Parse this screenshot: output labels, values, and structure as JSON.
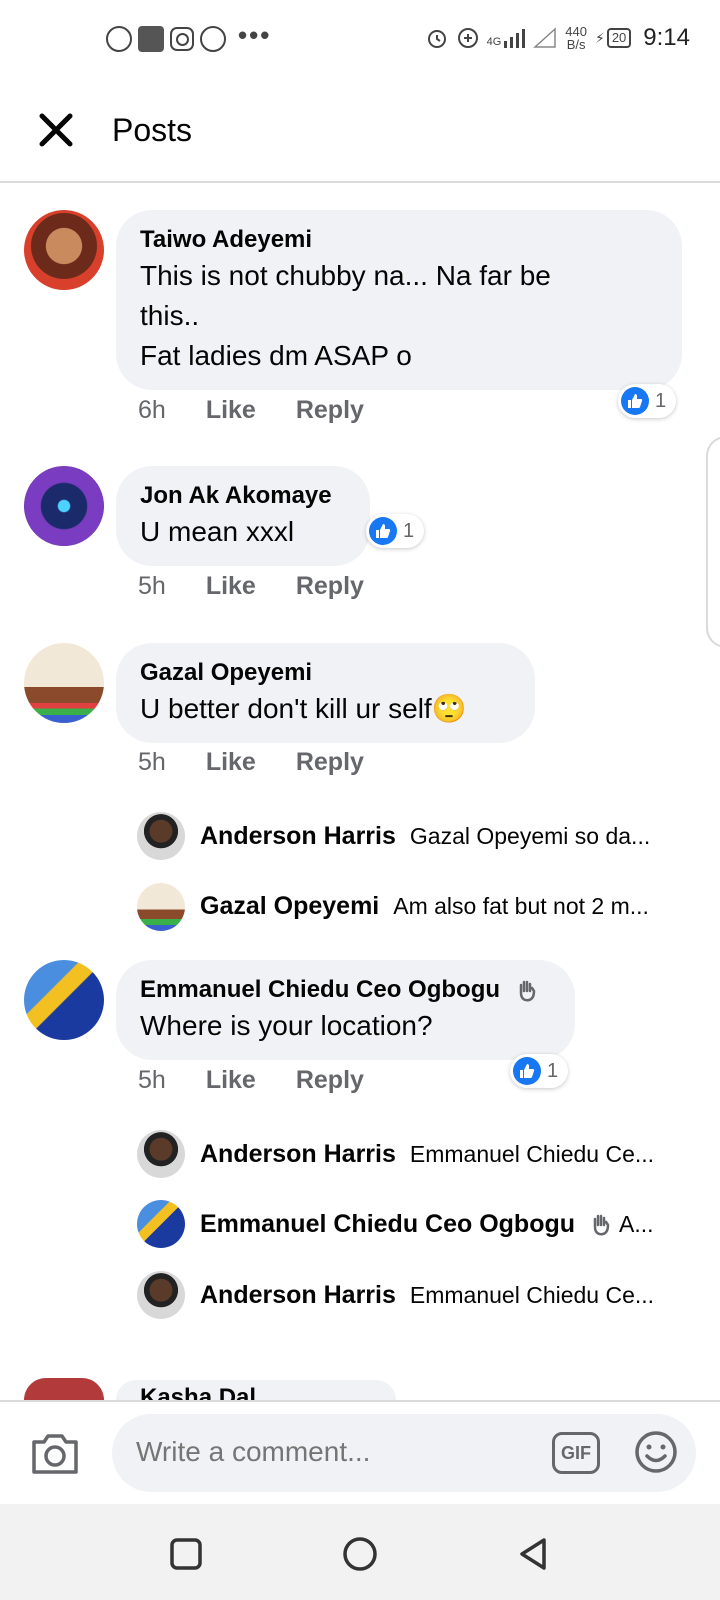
{
  "status_bar": {
    "time": "9:14",
    "net_speed": "440",
    "net_unit": "B/s",
    "network": "4G",
    "battery": "20"
  },
  "header": {
    "title": "Posts"
  },
  "comments": [
    {
      "author": "Taiwo Adeyemi",
      "text_lines": [
        "This is not chubby na... Na far be",
        "this..",
        "Fat ladies dm ASAP o"
      ],
      "time": "6h",
      "like_label": "Like",
      "reply_label": "Reply",
      "reactions": "1"
    },
    {
      "author": "Jon Ak Akomaye",
      "text_lines": [
        "U mean xxxl"
      ],
      "time": "5h",
      "like_label": "Like",
      "reply_label": "Reply",
      "reactions": "1"
    },
    {
      "author": "Gazal Opeyemi",
      "text_lines": [
        "U better don't kill ur self🙄"
      ],
      "time": "5h",
      "like_label": "Like",
      "reply_label": "Reply",
      "replies": [
        {
          "author": "Anderson Harris",
          "text": "Gazal Opeyemi so da..."
        },
        {
          "author": "Gazal Opeyemi",
          "text": "Am also fat but not 2 m..."
        }
      ]
    },
    {
      "author": "Emmanuel Chiedu Ceo Ogbogu",
      "text_lines": [
        "Where is your location?"
      ],
      "time": "5h",
      "like_label": "Like",
      "reply_label": "Reply",
      "reactions": "1",
      "replies": [
        {
          "author": "Anderson Harris",
          "text": "Emmanuel Chiedu Ce..."
        },
        {
          "author": "Emmanuel Chiedu Ceo Ogbogu",
          "text": "A..."
        },
        {
          "author": "Anderson Harris",
          "text": "Emmanuel Chiedu Ce..."
        }
      ]
    },
    {
      "author": "Kasha Dal..."
    }
  ],
  "composer": {
    "placeholder": "Write a comment...",
    "gif_label": "GIF"
  },
  "colors": {
    "accent": "#1877f2",
    "bubble": "#f0f2f5",
    "meta": "#65676b"
  }
}
